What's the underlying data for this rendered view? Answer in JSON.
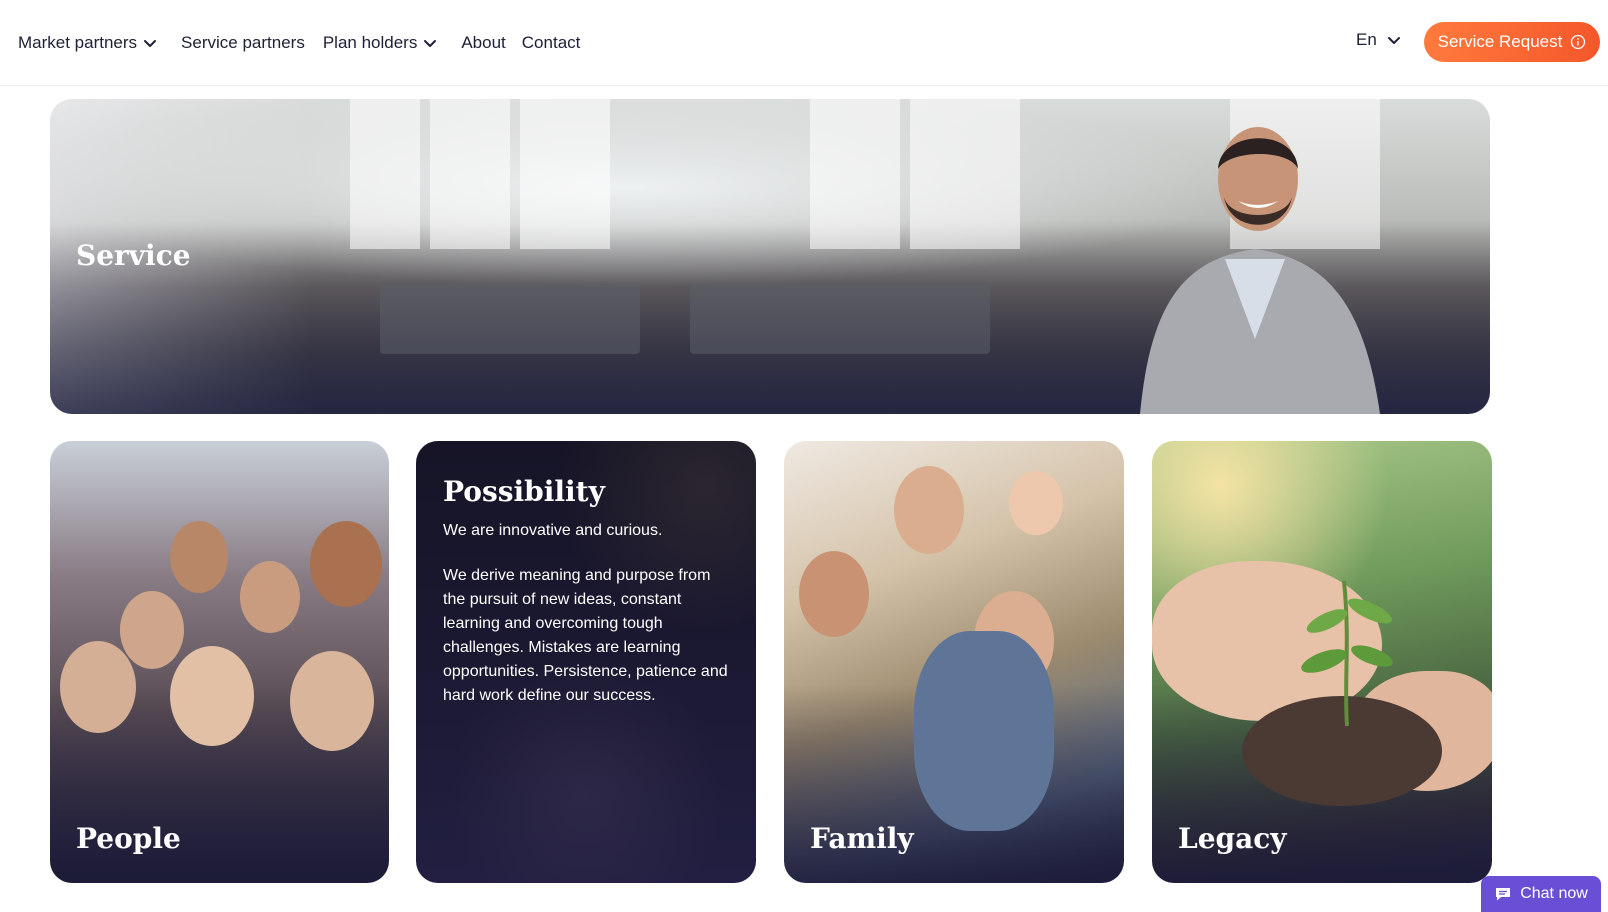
{
  "nav": {
    "items": [
      {
        "label": "Market partners",
        "dropdown": true
      },
      {
        "label": "Service partners",
        "dropdown": false
      },
      {
        "label": "Plan holders",
        "dropdown": true
      },
      {
        "label": "About",
        "dropdown": false
      },
      {
        "label": "Contact",
        "dropdown": false
      }
    ]
  },
  "language": {
    "label": "En"
  },
  "cta": {
    "label": "Service Request"
  },
  "cards": {
    "service": {
      "title": "Service"
    },
    "people": {
      "title": "People"
    },
    "possibility": {
      "title": "Possibility",
      "lead": "We are innovative and curious.",
      "body": "We derive meaning and purpose from the pursuit of new ideas, constant learning and overcoming tough challenges. Mistakes are learning opportunities. Persistence, patience and hard work define our success."
    },
    "family": {
      "title": "Family"
    },
    "legacy": {
      "title": "Legacy"
    }
  },
  "chat": {
    "label": "Chat now"
  },
  "colors": {
    "accent": "#f4572a",
    "chat": "#6a4fd6",
    "text": "#1d2036"
  }
}
